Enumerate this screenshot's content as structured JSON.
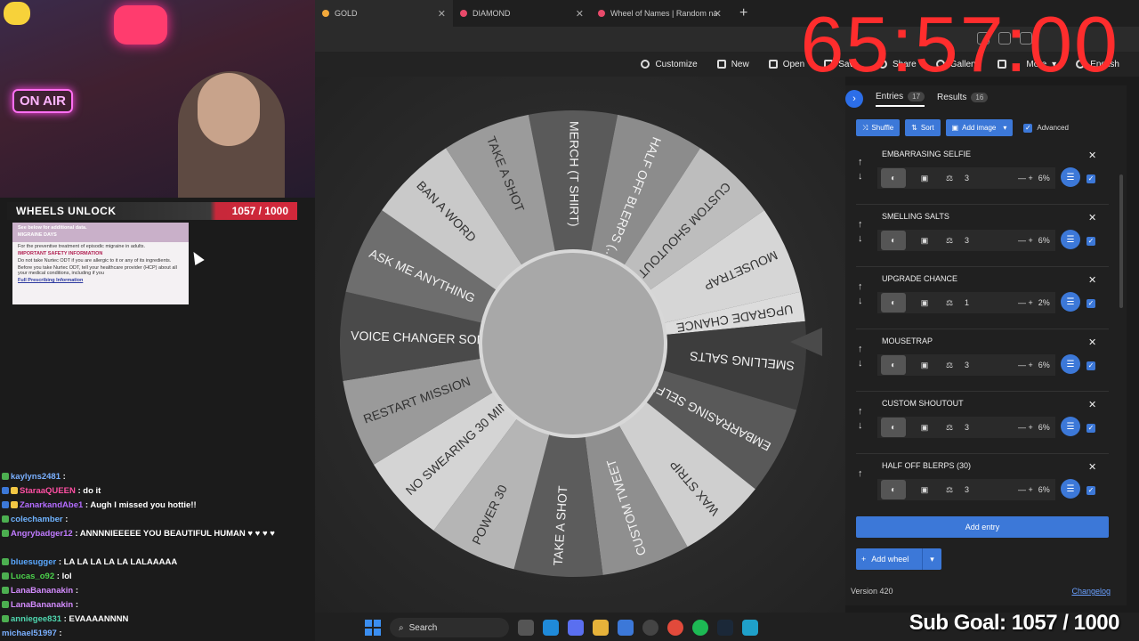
{
  "browser": {
    "tabs": [
      {
        "label": "GOLD",
        "color": "#f2a93b"
      },
      {
        "label": "DIAMOND",
        "color": "#e84a6a"
      },
      {
        "label": "Wheel of Names | Random name",
        "color": "#e84a6a"
      }
    ],
    "new_tab": "+"
  },
  "timer": "65:57:00",
  "toolbar": {
    "customize": "Customize",
    "new": "New",
    "open": "Open",
    "save": "Save",
    "share": "Share",
    "gallery": "Gallery",
    "more": "More",
    "language": "English"
  },
  "overlay": {
    "onair": "ON AIR",
    "wheels_label": "WHEELS UNLOCK",
    "wheels_value": "1057 / 1000",
    "subgoal": "Sub Goal: 1057 / 1000"
  },
  "ad": {
    "head": "MIGRAINE DAYS",
    "see_below": "See below for additional data.",
    "line1": "For the preventive treatment of episodic migraine in adults.",
    "safety": "IMPORTANT SAFETY INFORMATION",
    "line2": "Do not take Nurtec ODT if you are allergic to it or any of its ingredients.",
    "line3": "Before you take Nurtec ODT, tell your healthcare provider (HCP) about all your medical conditions, including if you",
    "link": "Full Prescribing Information"
  },
  "chat": [
    {
      "user": "kaylyns2481",
      "color": "#7ab0ff",
      "text": ""
    },
    {
      "user": "StaraaQUEEN",
      "color": "#ff4fa3",
      "text": "do it"
    },
    {
      "user": "ZanarkandAbe1",
      "color": "#b36cff",
      "text": "Augh I missed you hottie!!"
    },
    {
      "user": "colechamber",
      "color": "#6fb3ff",
      "text": ""
    },
    {
      "user": "Angrybadger12",
      "color": "#c07bff",
      "text": "ANNNNIEEEEE YOU BEAUTIFUL HUMAN ♥ ♥ ♥ ♥"
    },
    {
      "user": "bluesugger",
      "color": "#5aa8ff",
      "text": "LA LA LA LA LA LALAAAAA"
    },
    {
      "user": "Lucas_o92",
      "color": "#4cd24c",
      "text": "lol"
    },
    {
      "user": "LanaBananakin",
      "color": "#d48cff",
      "text": ""
    },
    {
      "user": "LanaBananakin",
      "color": "#d48cff",
      "text": ""
    },
    {
      "user": "anniegee831",
      "color": "#4fd8b0",
      "text": "EVAAAANNNN"
    },
    {
      "user": "michael51997",
      "color": "#7ab0ff",
      "text": ""
    }
  ],
  "wheel": {
    "segments": [
      "MERCH (T SHIRT)",
      "HALF OFF BLERPS (...",
      "CUSTOM SHOUTOUT",
      "MOUSETRAP",
      "UPGRADE CHANCE",
      "SMELLING SALTS",
      "EMBARRASING SELFIE",
      "WAX STRIP",
      "CUSTOM TWEET",
      "TAKE A SHOT",
      "POWER 30",
      "NO SWEARING 30 MIN",
      "RESTART MISSION",
      "VOICE CHANGER SONG",
      "ASK ME ANYTHING",
      "BAN A WORD",
      "TAKE A SHOT"
    ],
    "weights": [
      3,
      3,
      3,
      3,
      1,
      3,
      3,
      3,
      3,
      3,
      3,
      3,
      3,
      3,
      3,
      3,
      3
    ],
    "colors": [
      "#5a5a5a",
      "#8c8c8c",
      "#bdbdbd",
      "#d6d6d6",
      "#dcdcdc",
      "#3d3d3d",
      "#595959",
      "#cfcfcf",
      "#8f8f8f",
      "#5c5c5c",
      "#b5b5b5",
      "#d4d4d4",
      "#9a9a9a",
      "#4a4a4a",
      "#6e6e6e",
      "#c9c9c9",
      "#9b9b9b"
    ]
  },
  "panel": {
    "entries_tab": "Entries",
    "entries_count": "17",
    "results_tab": "Results",
    "results_count": "16",
    "shuffle": "Shuffle",
    "sort": "Sort",
    "add_image": "Add image",
    "advanced": "Advanced",
    "items": [
      {
        "name": "EMBARRASING SELFIE",
        "weight": "3",
        "pct": "6%"
      },
      {
        "name": "SMELLING SALTS",
        "weight": "3",
        "pct": "6%"
      },
      {
        "name": "UPGRADE CHANCE",
        "weight": "1",
        "pct": "2%"
      },
      {
        "name": "MOUSETRAP",
        "weight": "3",
        "pct": "6%"
      },
      {
        "name": "CUSTOM SHOUTOUT",
        "weight": "3",
        "pct": "6%"
      },
      {
        "name": "HALF OFF BLERPS (30)",
        "weight": "3",
        "pct": "6%"
      }
    ],
    "add_entry": "Add entry",
    "add_wheel": "Add wheel",
    "version": "Version 420",
    "changelog": "Changelog"
  },
  "taskbar": {
    "search": "Search"
  }
}
